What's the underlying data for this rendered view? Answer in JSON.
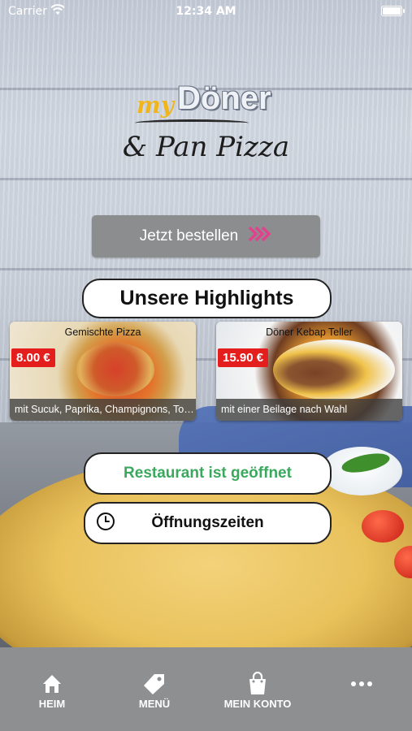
{
  "status_bar": {
    "carrier": "Carrier",
    "time": "12:34 AM"
  },
  "logo": {
    "my": "my",
    "brand": "Döner",
    "subtitle": "& Pan Pizza"
  },
  "order_button": {
    "label": "Jetzt bestellen",
    "icon": "double-chevron-right-icon",
    "accent": "#e0428d"
  },
  "highlights": {
    "title": "Unsere Highlights",
    "items": [
      {
        "name": "Gemischte Pizza",
        "price": "8.00 €",
        "description": "mit Sucuk, Paprika, Champignons, Toma..."
      },
      {
        "name": "Döner Kebap Teller",
        "price": "15.90 €",
        "description": "mit einer Beilage nach Wahl"
      }
    ]
  },
  "restaurant_status": {
    "label": "Restaurant ist geöffnet",
    "color": "#3aa95e"
  },
  "opening_hours": {
    "label": "Öffnungszeiten",
    "icon": "clock-icon"
  },
  "tab_bar": {
    "items": [
      {
        "label": "HEIM",
        "icon": "home-icon"
      },
      {
        "label": "MENÜ",
        "icon": "tag-icon"
      },
      {
        "label": "MEIN KONTO",
        "icon": "shopping-bag-icon"
      },
      {
        "label": "",
        "icon": "more-icon"
      }
    ]
  }
}
